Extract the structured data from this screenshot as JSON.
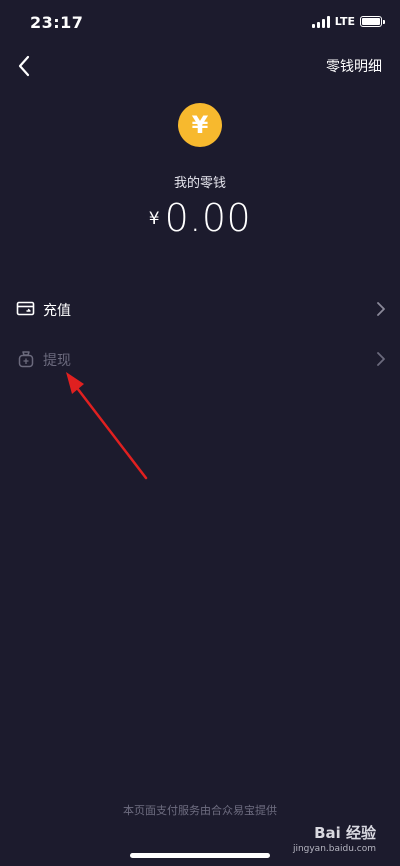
{
  "status_bar": {
    "time": "23:17",
    "network": "LTE"
  },
  "nav": {
    "back_icon": "chevron-left-icon",
    "right_link": "零钱明细"
  },
  "balance": {
    "coin_icon": "yuan-coin-icon",
    "coin_glyph": "¥",
    "label": "我的零钱",
    "currency": "¥",
    "amount": "0.00"
  },
  "menu": {
    "recharge": {
      "label": "充值",
      "icon": "card-icon"
    },
    "withdraw": {
      "label": "提现",
      "icon": "money-bag-icon"
    }
  },
  "footer": {
    "note": "本页面支付服务由合众易宝提供"
  },
  "watermark": {
    "logo": "Bai 经验",
    "url": "jingyan.baidu.com"
  },
  "colors": {
    "background": "#1c1b2d",
    "coin": "#f7b92e",
    "annotation_arrow": "#e02020",
    "disabled_text": "#6b6a7d"
  }
}
